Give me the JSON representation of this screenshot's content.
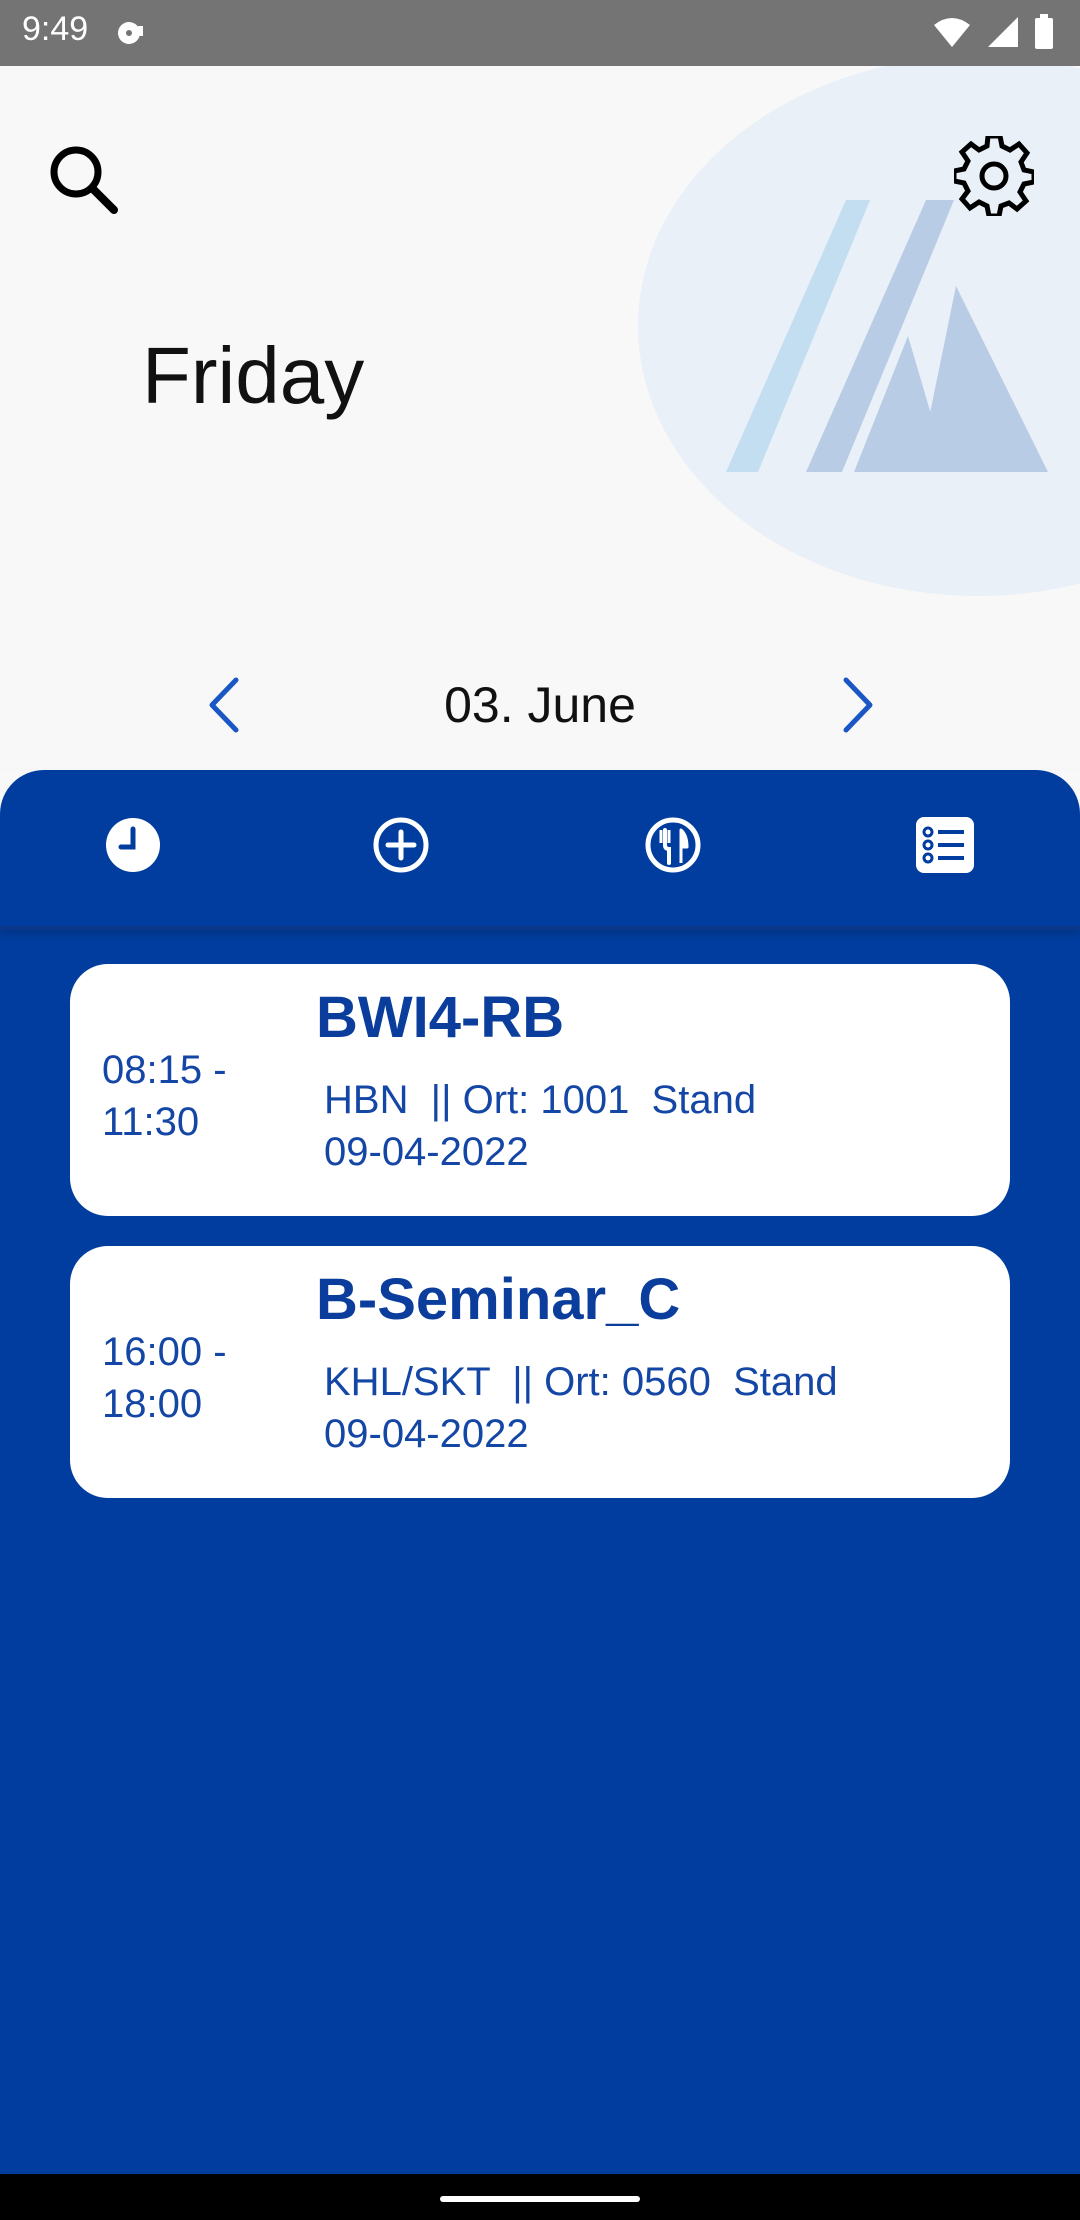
{
  "status_bar": {
    "time": "9:49",
    "icons": [
      "media-icon",
      "wifi-icon",
      "signal-icon",
      "battery-icon"
    ]
  },
  "header": {
    "day": "Friday",
    "date": "03. June",
    "icons": [
      "search-icon",
      "gear-icon",
      "chevron-left-icon",
      "chevron-right-icon"
    ]
  },
  "tabs": [
    {
      "name": "clock-icon",
      "active": true
    },
    {
      "name": "add-circle-icon",
      "active": false
    },
    {
      "name": "cutlery-icon",
      "active": false
    },
    {
      "name": "list-icon",
      "active": false
    }
  ],
  "events": [
    {
      "time": "08:15 -\n11:30",
      "course": "BWI4-RB",
      "info": "HBN  || Ort: 1001  Stand\n09-04-2022"
    },
    {
      "time": "16:00 -\n18:00",
      "course": "B-Seminar_C",
      "info": "KHL/SKT  || Ort: 0560  Stand\n09-04-2022"
    }
  ],
  "colors": {
    "primary": "#003d9e",
    "card_text": "#1446a6",
    "header_bg": "#f8f8f8",
    "status_bar": "#747474"
  }
}
